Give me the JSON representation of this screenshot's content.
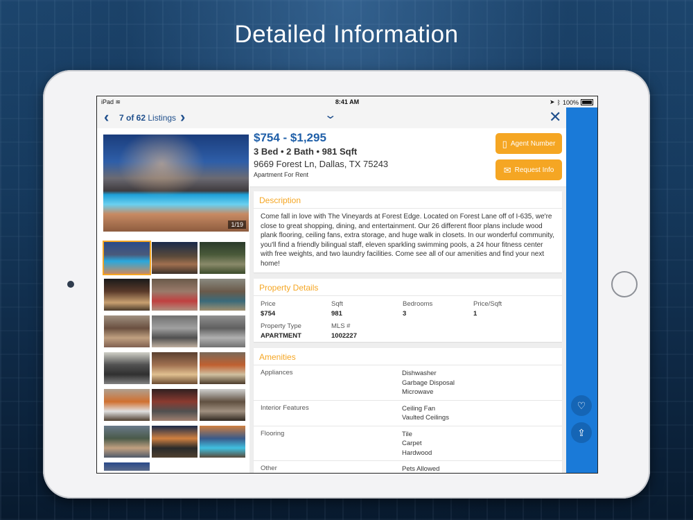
{
  "headline": "Detailed Information",
  "status_bar": {
    "device": "iPad",
    "time": "8:41 AM",
    "battery": "100%"
  },
  "nav": {
    "counter_current": "7 of 62",
    "counter_suffix": "Listings"
  },
  "listing": {
    "price_range": "$754 - $1,295",
    "beds_baths_sqft": "3 Bed • 2 Bath • 981 Sqft",
    "address": "9669 Forest Ln, Dallas, TX 75243",
    "property_type": "Apartment For Rent",
    "photo_counter": "1/19"
  },
  "actions": {
    "agent_number": "Agent Number",
    "request_info": "Request Info"
  },
  "description": {
    "title": "Description",
    "text": "Come fall in love with The Vineyards at Forest Edge. Located on Forest Lane off of I-635, we're close to great shopping, dining, and entertainment. Our 26 different floor plans include wood plank flooring, ceiling fans, extra storage, and huge walk in closets. In our wonderful community, you'll find a friendly bilingual staff, eleven sparkling swimming pools, a 24 hour fitness center with free weights, and two laundry facilities. Come see all of our amenities and find your next home!"
  },
  "property_details": {
    "title": "Property Details",
    "fields": [
      {
        "label": "Price",
        "value": "$754"
      },
      {
        "label": "Sqft",
        "value": "981"
      },
      {
        "label": "Bedrooms",
        "value": "3"
      },
      {
        "label": "Price/Sqft",
        "value": "1"
      },
      {
        "label": "Property Type",
        "value": "APARTMENT"
      },
      {
        "label": "MLS #",
        "value": "1002227"
      }
    ]
  },
  "amenities": {
    "title": "Amenities",
    "rows": [
      {
        "label": "Appliances",
        "values": [
          "Dishwasher",
          "Garbage Disposal",
          "Microwave"
        ]
      },
      {
        "label": "Interior Features",
        "values": [
          "Ceiling Fan",
          "Vaulted Ceilings"
        ]
      },
      {
        "label": "Flooring",
        "values": [
          "Tile",
          "Carpet",
          "Hardwood"
        ]
      },
      {
        "label": "Other",
        "values": [
          "Pets Allowed"
        ]
      }
    ]
  },
  "icons": {
    "prev": "chevron-left-icon",
    "next": "chevron-right-icon",
    "collapse": "chevron-down-icon",
    "close": "close-icon",
    "favorite": "heart-icon",
    "share": "share-icon",
    "phone": "phone-icon",
    "mail": "mail-icon"
  },
  "colors": {
    "accent_orange": "#f5a623",
    "brand_blue": "#1f5fa8",
    "rail_blue": "#1a7ad8"
  }
}
